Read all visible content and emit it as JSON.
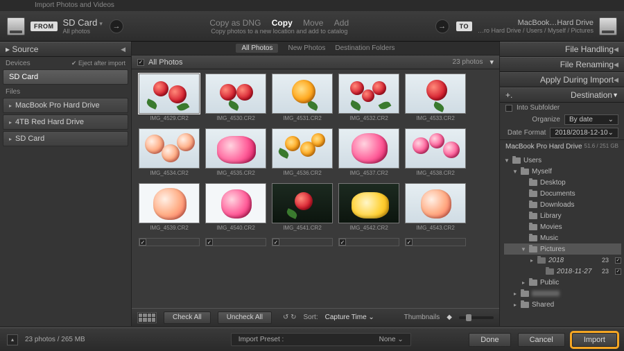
{
  "title": "Import Photos and Videos",
  "top": {
    "from_badge": "FROM",
    "source": "SD Card",
    "source_sub": "All photos",
    "modes": [
      "Copy as DNG",
      "Copy",
      "Move",
      "Add"
    ],
    "mode_selected": "Copy",
    "mode_sub": "Copy photos to a new location and add to catalog",
    "to_badge": "TO",
    "dest": "MacBook…Hard Drive",
    "dest_sub": "…ro Hard Drive / Users / Myself / Pictures"
  },
  "left": {
    "header": "Source",
    "devices_label": "Devices",
    "eject_label": "Eject after import",
    "devices": [
      "SD Card"
    ],
    "files_label": "Files",
    "files": [
      "MacBook Pro Hard Drive",
      "4TB Red Hard Drive",
      "SD Card"
    ]
  },
  "center": {
    "tabs": [
      "All Photos",
      "New Photos",
      "Destination Folders"
    ],
    "tab_selected": "All Photos",
    "header": "All Photos",
    "count": "23 photos",
    "check_all": "Check All",
    "uncheck_all": "Uncheck All",
    "sort_label": "Sort:",
    "sort_value": "Capture Time",
    "thumbnails_label": "Thumbnails",
    "photos": [
      {
        "f": "IMG_4529.CR2",
        "v": "a"
      },
      {
        "f": "IMG_4530.CR2",
        "v": "b"
      },
      {
        "f": "IMG_4531.CR2",
        "v": "c"
      },
      {
        "f": "IMG_4532.CR2",
        "v": "d"
      },
      {
        "f": "IMG_4533.CR2",
        "v": "e"
      },
      {
        "f": "IMG_4534.CR2",
        "v": "f"
      },
      {
        "f": "IMG_4535.CR2",
        "v": "g"
      },
      {
        "f": "IMG_4536.CR2",
        "v": "h"
      },
      {
        "f": "IMG_4537.CR2",
        "v": "i"
      },
      {
        "f": "IMG_4538.CR2",
        "v": "j"
      },
      {
        "f": "IMG_4539.CR2",
        "v": "k"
      },
      {
        "f": "IMG_4540.CR2",
        "v": "l"
      },
      {
        "f": "IMG_4541.CR2",
        "v": "m"
      },
      {
        "f": "IMG_4542.CR2",
        "v": "n"
      },
      {
        "f": "IMG_4543.CR2",
        "v": "o"
      }
    ]
  },
  "right": {
    "sections": [
      "File Handling",
      "File Renaming",
      "Apply During Import",
      "Destination"
    ],
    "into_subfolder": "Into Subfolder",
    "organize_label": "Organize",
    "organize_value": "By date",
    "dateformat_label": "Date Format",
    "dateformat_value": "2018/2018-12-10",
    "drive": "MacBook Pro Hard Drive",
    "drive_stats": "51.6 / 251 GB",
    "tree": {
      "root": "Users",
      "user": "Myself",
      "children": [
        "Desktop",
        "Documents",
        "Downloads",
        "Library",
        "Movies",
        "Music"
      ],
      "pictures": "Pictures",
      "year": {
        "label": "2018",
        "count": "23"
      },
      "date": {
        "label": "2018-11-27",
        "count": "23"
      },
      "extra": [
        "Public",
        "",
        "Shared"
      ]
    }
  },
  "bottom": {
    "status": "23 photos / 265 MB",
    "preset_label": "Import Preset :",
    "preset_value": "None",
    "done": "Done",
    "cancel": "Cancel",
    "import": "Import"
  }
}
